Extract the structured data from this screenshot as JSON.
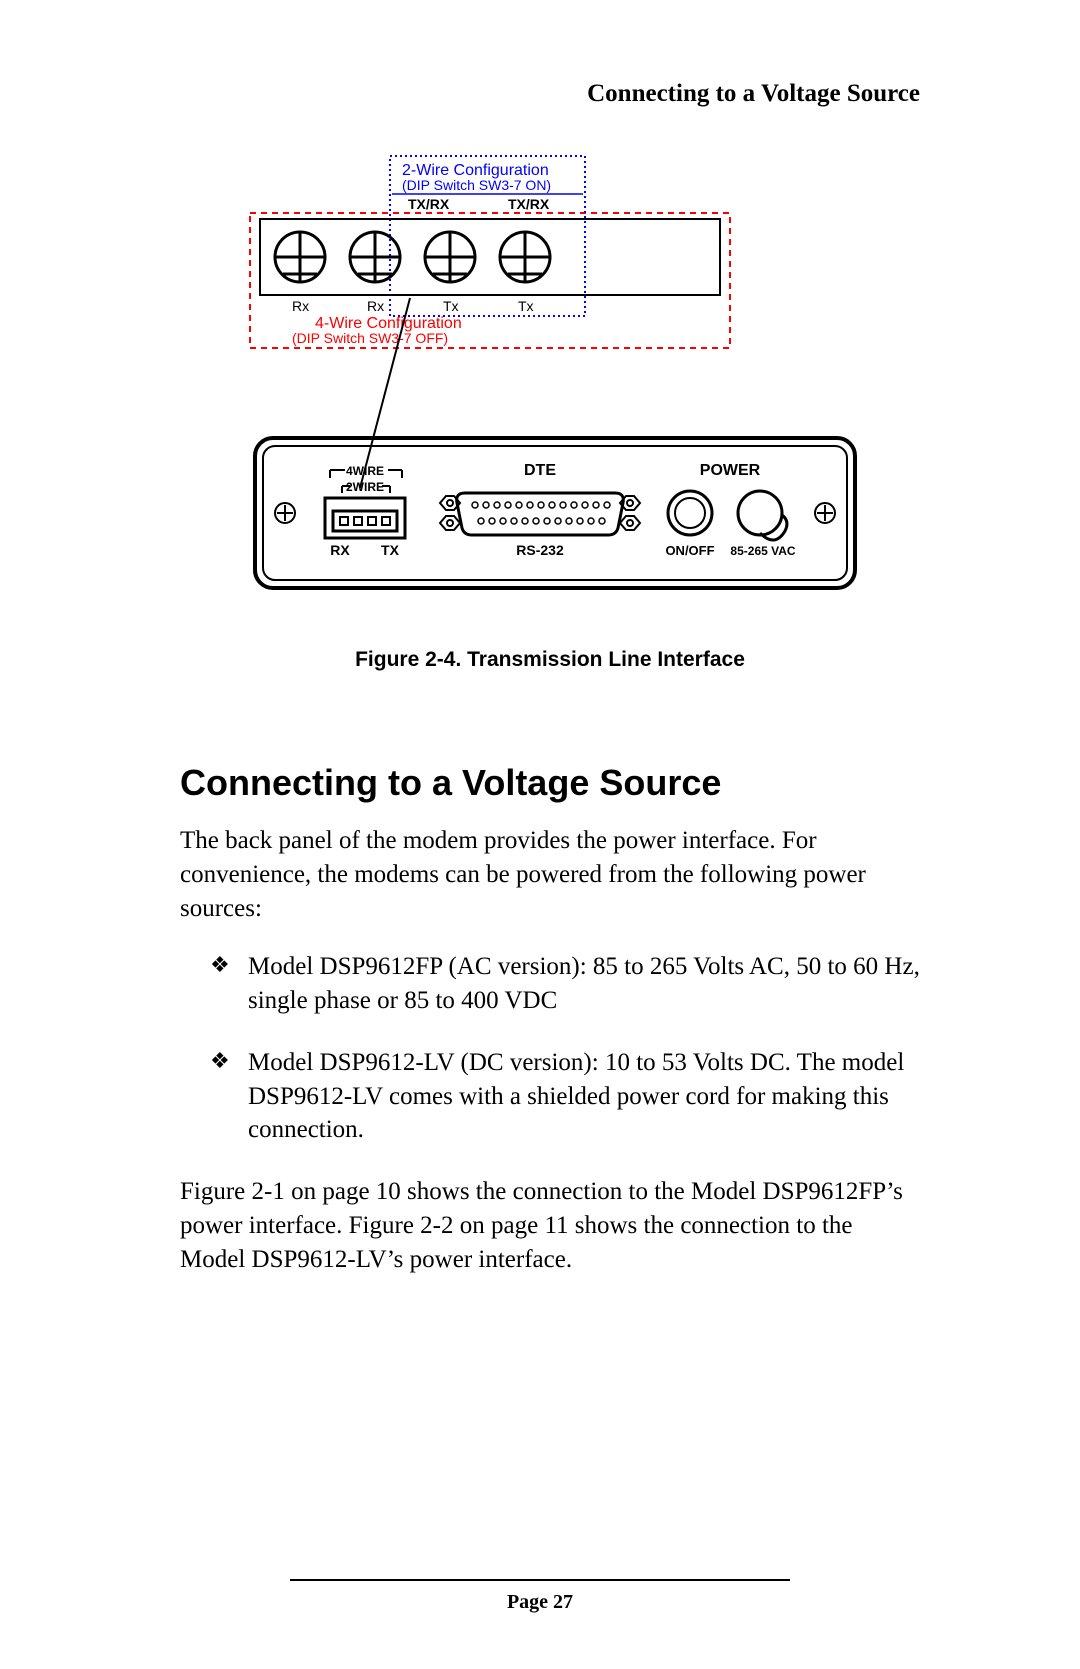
{
  "header": {
    "title": "Connecting to a Voltage Source"
  },
  "figure": {
    "config2_title": "2-Wire Configuration",
    "config2_sub": "(DIP Switch SW3-7 ON)",
    "txrx_label": "TX/RX",
    "rx_label": "Rx",
    "tx_label": "Tx",
    "config4_title": "4-Wire Configuration",
    "config4_sub": "(DIP Switch SW3-7 OFF)",
    "panel": {
      "four_wire": "4WIRE",
      "two_wire": "2WIRE",
      "dte": "DTE",
      "power": "POWER",
      "onoff": "ON/OFF",
      "vac": "85-265 VAC",
      "rs232": "RS-232",
      "rx": "RX",
      "tx": "TX"
    },
    "caption": "Figure 2-4. Transmission Line Interface"
  },
  "section": {
    "heading": "Connecting to a Voltage Source",
    "intro": "The back panel of the modem provides the power interface. For convenience, the modems can be powered from the following power sources:",
    "bullets": [
      "Model DSP9612FP (AC version): 85 to 265 Volts AC, 50 to 60 Hz, single phase or 85 to 400 VDC",
      "Model DSP9612-LV (DC version): 10 to 53 Volts DC. The model DSP9612-LV  comes with a shielded power cord for making this connection."
    ],
    "closing": "Figure 2-1 on page 10 shows the connection to the Model DSP9612FP’s power interface. Figure 2-2 on page 11 shows the connection to the Model DSP9612-LV’s power interface."
  },
  "footer": {
    "page": "Page 27"
  }
}
